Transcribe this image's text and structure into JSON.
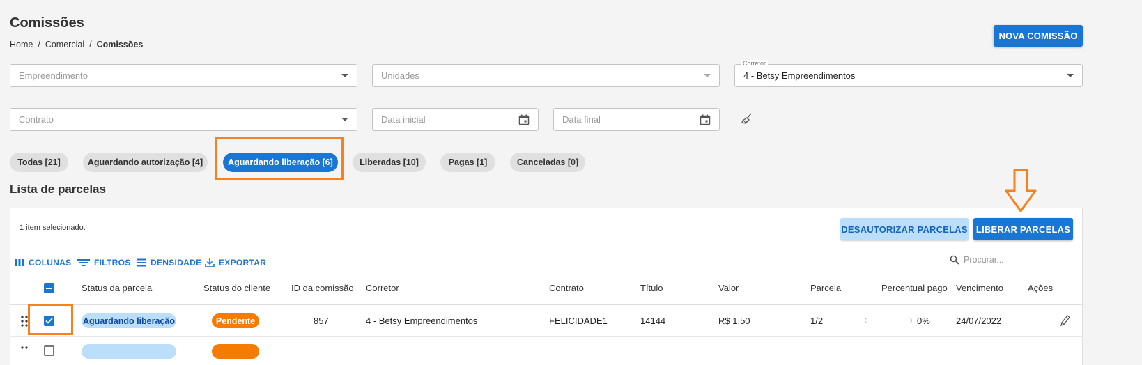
{
  "header": {
    "title": "Comissões",
    "breadcrumb": [
      "Home",
      "/",
      "Comercial",
      "/",
      "Comissões"
    ],
    "new_button": "NOVA COMISSÃO"
  },
  "filters": {
    "empreendimento": {
      "placeholder": "Empreendimento"
    },
    "unidades": {
      "placeholder": "Unidades"
    },
    "corretor": {
      "label": "Corretor",
      "value": "4 - Betsy Empreendimentos"
    },
    "contrato": {
      "placeholder": "Contrato"
    },
    "data_inicial": {
      "placeholder": "Data inicial"
    },
    "data_final": {
      "placeholder": "Data final"
    }
  },
  "tabs": [
    {
      "label": "Todas [21]"
    },
    {
      "label": "Aguardando autorização [4]"
    },
    {
      "label": "Aguardando liberação [6]",
      "active": true
    },
    {
      "label": "Liberadas [10]"
    },
    {
      "label": "Pagas [1]"
    },
    {
      "label": "Canceladas [0]"
    }
  ],
  "list": {
    "title": "Lista de parcelas",
    "selection_info": "1 item selecionado.",
    "deauthorize_button": "DESAUTORIZAR PARCELAS",
    "release_button": "LIBERAR PARCELAS",
    "toolbar": {
      "columns": "COLUNAS",
      "filters": "FILTROS",
      "density": "DENSIDADE",
      "export": "EXPORTAR"
    },
    "search_placeholder": "Procurar...",
    "columns": [
      "Status da parcela",
      "Status do cliente",
      "ID da comissão",
      "Corretor",
      "Contrato",
      "Título",
      "Valor",
      "Parcela",
      "Percentual pago",
      "Vencimento",
      "Ações"
    ],
    "rows": [
      {
        "status_parcela": "Aguardando liberação",
        "status_cliente": "Pendente",
        "id": "857",
        "corretor": "4 - Betsy Empreendimentos",
        "contrato": "FELICIDADE1",
        "titulo": "14144",
        "valor": "R$ 1,50",
        "parcela": "1/2",
        "percentual": "0%",
        "percentual_value": 0,
        "vencimento": "24/07/2022",
        "selected": true
      }
    ]
  },
  "colors": {
    "primary": "#1976d2",
    "light_primary": "#bbdefb",
    "warning": "#f57c00",
    "highlight": "#f5821f"
  }
}
